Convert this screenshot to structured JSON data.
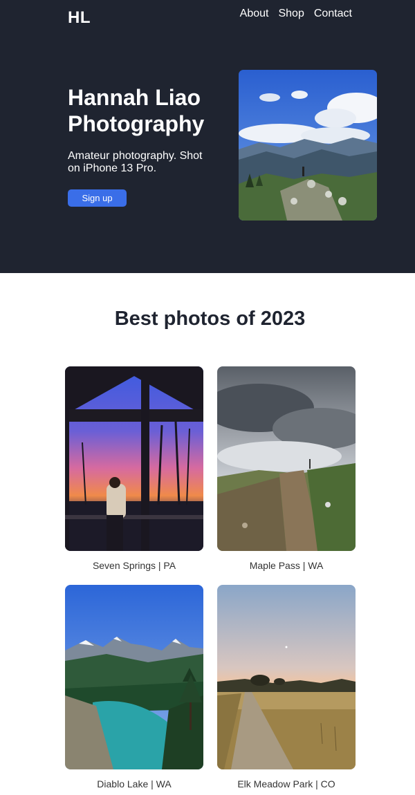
{
  "header": {
    "logo": "HL",
    "nav": [
      {
        "label": "About"
      },
      {
        "label": "Shop"
      },
      {
        "label": "Contact"
      }
    ]
  },
  "hero": {
    "title": "Hannah Liao Photography",
    "subtitle": "Amateur photography. Shot on iPhone 13 Pro.",
    "cta_label": "Sign up"
  },
  "gallery": {
    "title": "Best photos of 2023",
    "items": [
      {
        "caption": "Seven Springs | PA"
      },
      {
        "caption": "Maple Pass | WA"
      },
      {
        "caption": "Diablo Lake | WA"
      },
      {
        "caption": "Elk Meadow Park | CO"
      }
    ]
  },
  "colors": {
    "hero_bg": "#1f2430",
    "accent": "#3a6ee8",
    "text_dark": "#1f2430"
  }
}
